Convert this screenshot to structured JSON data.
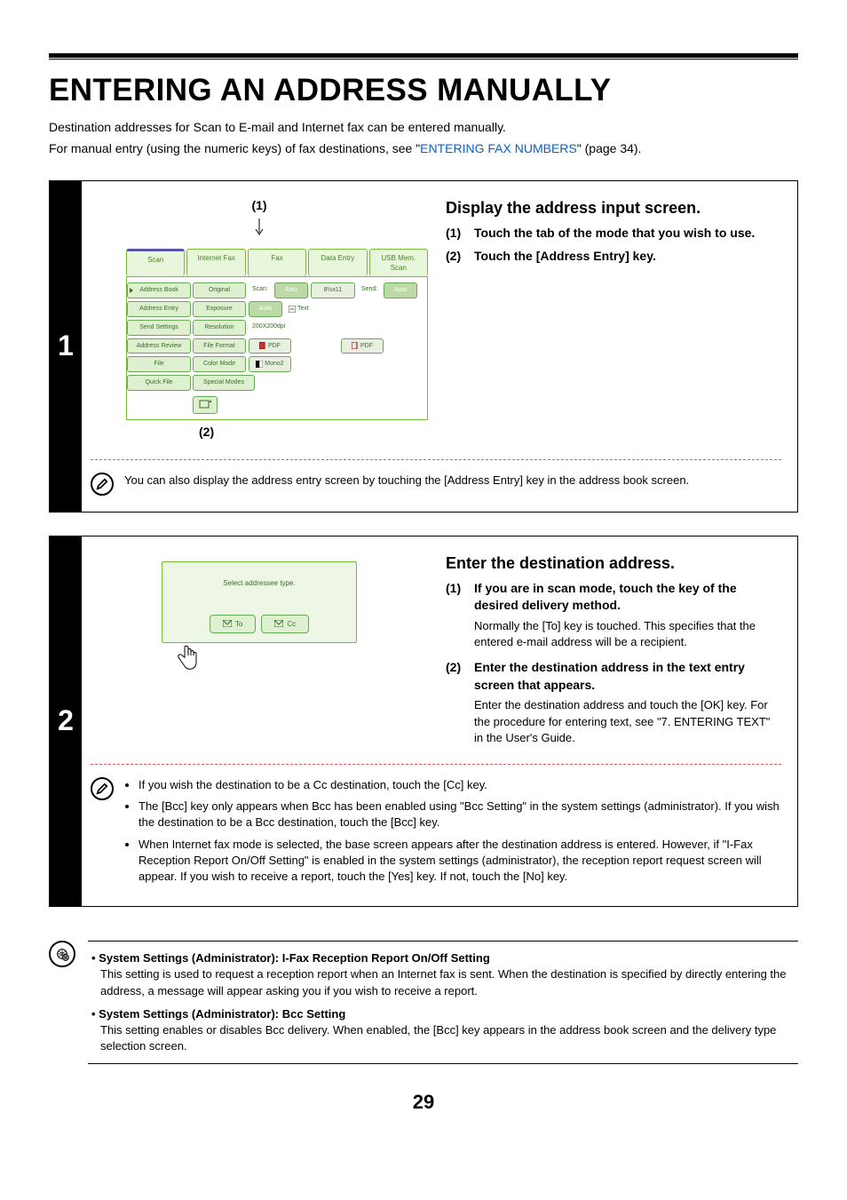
{
  "title": "ENTERING AN ADDRESS MANUALLY",
  "intro_line1": "Destination addresses for Scan to E-mail and Internet fax can be entered manually.",
  "intro_line2_pre": "For manual entry (using the numeric keys) of fax destinations, see \"",
  "intro_line2_link": "ENTERING FAX NUMBERS",
  "intro_line2_post": "\" (page 34).",
  "step1": {
    "number": "1",
    "callout_top": "(1)",
    "callout_bottom": "(2)",
    "heading": "Display the address input screen.",
    "substeps": [
      {
        "num": "(1)",
        "text": "Touch the tab of the mode that you wish to use."
      },
      {
        "num": "(2)",
        "text": "Touch the [Address Entry] key."
      }
    ],
    "screen": {
      "tabs": [
        "Scan",
        "Internet Fax",
        "Fax",
        "Data Entry",
        "USB Mem. Scan"
      ],
      "sidebuttons": [
        "Address Book",
        "Address Entry",
        "Send Settings",
        "Address Review",
        "File",
        "Quick File"
      ],
      "rows": {
        "original": {
          "label": "Original",
          "scan_label": "Scan:",
          "scan_val": "Auto",
          "size": "8½x11",
          "send_label": "Send:",
          "send_val": "Auto"
        },
        "exposure": {
          "label": "Exposure",
          "val": "Auto",
          "extra_icon_label": "Text"
        },
        "resolution": {
          "label": "Resolution",
          "val": "200X200dpi"
        },
        "fileformat": {
          "label": "File Format",
          "val1": "PDF",
          "val2": "PDF"
        },
        "colormode": {
          "label": "Color Mode",
          "val": "Mono2"
        },
        "special": {
          "label": "Special Modes"
        }
      }
    },
    "note": "You can also display the address entry screen by touching the [Address Entry] key in the address book screen."
  },
  "step2": {
    "number": "2",
    "heading": "Enter the destination address.",
    "screen": {
      "prompt": "Select addressee type.",
      "to_label": "To",
      "cc_label": "Cc"
    },
    "substeps": [
      {
        "num": "(1)",
        "text": "If you are in scan mode, touch the key of the desired delivery method.",
        "desc": "Normally the [To] key is touched. This specifies that the entered e-mail address will be a recipient."
      },
      {
        "num": "(2)",
        "text": "Enter the destination address in the text entry screen that appears.",
        "desc": "Enter the destination address and touch the [OK] key. For the procedure for entering text, see \"7. ENTERING TEXT\" in the User's Guide."
      }
    ],
    "notes": [
      "If you wish the destination to be a Cc destination, touch the [Cc] key.",
      "The [Bcc] key only appears when Bcc has been enabled using \"Bcc Setting\" in the system settings (administrator). If you wish the destination to be a Bcc destination, touch the [Bcc] key.",
      "When Internet fax mode is selected, the base screen appears after the destination address is entered. However, if \"I-Fax Reception Report On/Off Setting\" is enabled in the system settings (administrator), the reception report request screen will appear. If you wish to receive a report, touch the [Yes] key. If not, touch the [No] key."
    ]
  },
  "admin": [
    {
      "title": "• System Settings (Administrator): I-Fax Reception Report On/Off Setting",
      "desc": "This setting is used to request a reception report when an Internet fax is sent. When the destination is specified by directly entering the address, a message will appear asking you if you wish to receive a report."
    },
    {
      "title": "• System Settings (Administrator): Bcc Setting",
      "desc": "This setting enables or disables Bcc delivery. When enabled, the [Bcc] key appears in the address book screen and the delivery type selection screen."
    }
  ],
  "page_number": "29"
}
